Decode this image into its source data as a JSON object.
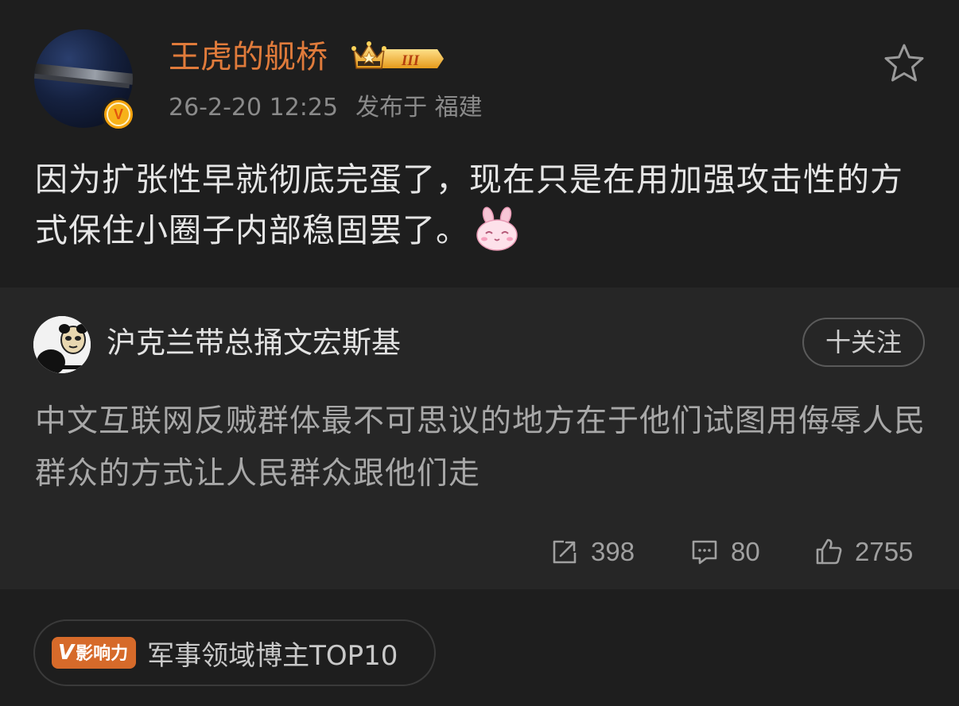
{
  "post": {
    "username": "王虎的舰桥",
    "member_level": "III",
    "timestamp": "26-2-20 12:25",
    "location": "发布于 福建",
    "text": "因为扩张性早就彻底完蛋了，现在只是在用加强攻击性的方式保住小圈子内部稳固罢了。",
    "verified_badge": "V",
    "emoji_icon": "bunny-smile-emoji-icon"
  },
  "repost": {
    "author": "沪克兰带总捅文宏斯基",
    "follow_label": "十关注",
    "text": "中文互联网反贼群体最不可思议的地方在于他们试图用侮辱人民群众的方式让人民群众跟他们走",
    "stats": {
      "reposts": "398",
      "comments": "80",
      "likes": "2755"
    }
  },
  "footer": {
    "influence_tag": "影响力",
    "influence_v": "V",
    "influence_text": "军事领域博主TOP10"
  },
  "colors": {
    "background": "#1e1e1e",
    "repost_background": "#262626",
    "username": "#e07b3b",
    "influence_tag": "#d66a2a"
  }
}
